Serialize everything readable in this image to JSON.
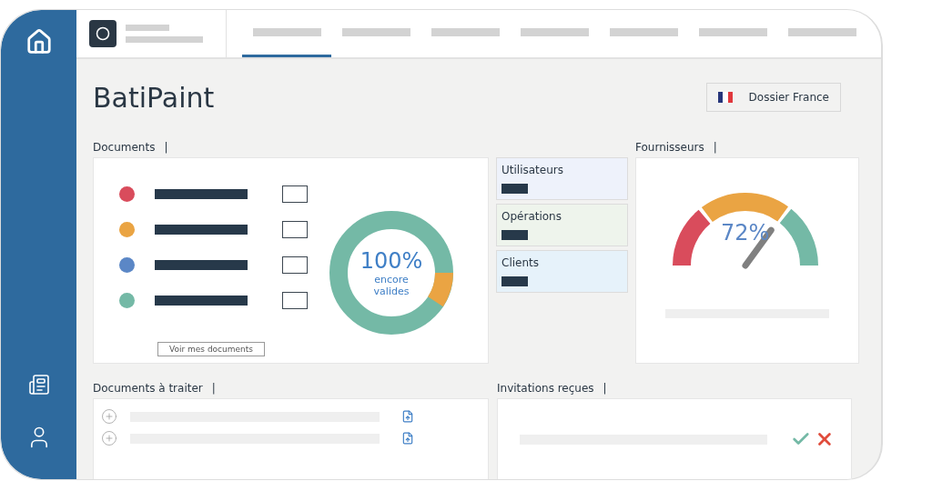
{
  "nav_tabs": [
    {
      "selected": true
    },
    {
      "selected": false
    },
    {
      "selected": false
    },
    {
      "selected": false
    },
    {
      "selected": false
    },
    {
      "selected": false
    },
    {
      "selected": false
    }
  ],
  "page_title": "BatiPaint",
  "folder_button": {
    "label": "Dossier France"
  },
  "documents": {
    "title": "Documents",
    "mark": "|",
    "rows": [
      {
        "color": "#d94c5c",
        "checked": false
      },
      {
        "color": "#eaa443",
        "checked": false
      },
      {
        "color": "#5b87c6",
        "checked": false
      },
      {
        "color": "#74b9a6",
        "checked": false
      }
    ],
    "link": "Voir mes documents",
    "donut_value": "100%",
    "donut_caption": "encore valides"
  },
  "stats": [
    {
      "label": "Utilisateurs",
      "color": "#eef2fb"
    },
    {
      "label": "Opérations",
      "color": "#eef4ec"
    },
    {
      "label": "Clients",
      "color": "#e6f2fa"
    }
  ],
  "suppliers": {
    "title": "Fournisseurs",
    "mark": "|",
    "reading": "72%"
  },
  "to_process": {
    "title": "Documents à traiter",
    "mark": "|",
    "rows": [
      {
        "kind": "document"
      },
      {
        "kind": "document"
      }
    ]
  },
  "invitations": {
    "title": "Invitations reçues",
    "mark": "|"
  }
}
